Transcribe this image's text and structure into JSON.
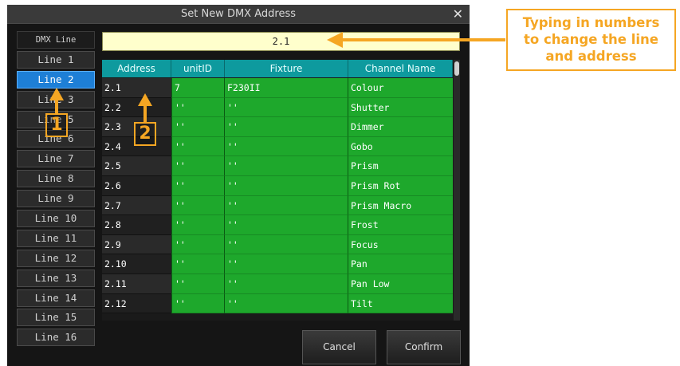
{
  "dialog": {
    "title": "Set New DMX Address",
    "close_glyph": "✕",
    "address_value": "2.1",
    "sidebar": {
      "header": "DMX Line",
      "items": [
        "Line 1",
        "Line 2",
        "Line 3",
        "Line 5",
        "Line 6",
        "Line 7",
        "Line 8",
        "Line 9",
        "Line 10",
        "Line 11",
        "Line 12",
        "Line 13",
        "Line 14",
        "Line 15",
        "Line 16"
      ],
      "active": "Line 2"
    },
    "table": {
      "columns": [
        "Address",
        "unitID",
        "Fixture",
        "Channel Name"
      ],
      "rows": [
        [
          "2.1",
          "7",
          "F230II",
          "Colour"
        ],
        [
          "2.2",
          "''",
          "''",
          "Shutter"
        ],
        [
          "2.3",
          "''",
          "''",
          "Dimmer"
        ],
        [
          "2.4",
          "''",
          "''",
          "Gobo"
        ],
        [
          "2.5",
          "''",
          "''",
          "Prism"
        ],
        [
          "2.6",
          "''",
          "''",
          "Prism Rot"
        ],
        [
          "2.7",
          "''",
          "''",
          "Prism Macro"
        ],
        [
          "2.8",
          "''",
          "''",
          "Frost"
        ],
        [
          "2.9",
          "''",
          "''",
          "Focus"
        ],
        [
          "2.10",
          "''",
          "''",
          "Pan"
        ],
        [
          "2.11",
          "''",
          "''",
          "Pan Low"
        ],
        [
          "2.12",
          "''",
          "''",
          "Tilt"
        ]
      ]
    },
    "buttons": {
      "cancel": "Cancel",
      "confirm": "Confirm"
    }
  },
  "annotations": {
    "callout_lines": [
      "Typing in numbers",
      "to change the line",
      "and address"
    ],
    "marker_1": "1",
    "marker_2": "2",
    "accent_color": "#f5a623"
  }
}
